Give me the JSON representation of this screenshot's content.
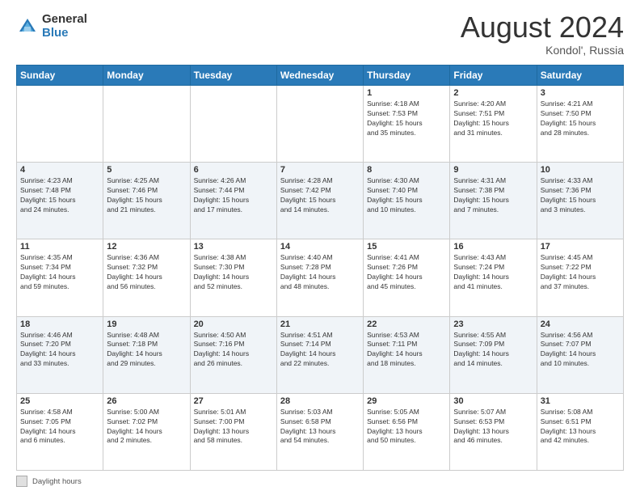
{
  "header": {
    "logo_general": "General",
    "logo_blue": "Blue",
    "month_title": "August 2024",
    "location": "Kondol', Russia"
  },
  "footer": {
    "label": "Daylight hours"
  },
  "days_of_week": [
    "Sunday",
    "Monday",
    "Tuesday",
    "Wednesday",
    "Thursday",
    "Friday",
    "Saturday"
  ],
  "weeks": [
    [
      {
        "num": "",
        "info": ""
      },
      {
        "num": "",
        "info": ""
      },
      {
        "num": "",
        "info": ""
      },
      {
        "num": "",
        "info": ""
      },
      {
        "num": "1",
        "info": "Sunrise: 4:18 AM\nSunset: 7:53 PM\nDaylight: 15 hours\nand 35 minutes."
      },
      {
        "num": "2",
        "info": "Sunrise: 4:20 AM\nSunset: 7:51 PM\nDaylight: 15 hours\nand 31 minutes."
      },
      {
        "num": "3",
        "info": "Sunrise: 4:21 AM\nSunset: 7:50 PM\nDaylight: 15 hours\nand 28 minutes."
      }
    ],
    [
      {
        "num": "4",
        "info": "Sunrise: 4:23 AM\nSunset: 7:48 PM\nDaylight: 15 hours\nand 24 minutes."
      },
      {
        "num": "5",
        "info": "Sunrise: 4:25 AM\nSunset: 7:46 PM\nDaylight: 15 hours\nand 21 minutes."
      },
      {
        "num": "6",
        "info": "Sunrise: 4:26 AM\nSunset: 7:44 PM\nDaylight: 15 hours\nand 17 minutes."
      },
      {
        "num": "7",
        "info": "Sunrise: 4:28 AM\nSunset: 7:42 PM\nDaylight: 15 hours\nand 14 minutes."
      },
      {
        "num": "8",
        "info": "Sunrise: 4:30 AM\nSunset: 7:40 PM\nDaylight: 15 hours\nand 10 minutes."
      },
      {
        "num": "9",
        "info": "Sunrise: 4:31 AM\nSunset: 7:38 PM\nDaylight: 15 hours\nand 7 minutes."
      },
      {
        "num": "10",
        "info": "Sunrise: 4:33 AM\nSunset: 7:36 PM\nDaylight: 15 hours\nand 3 minutes."
      }
    ],
    [
      {
        "num": "11",
        "info": "Sunrise: 4:35 AM\nSunset: 7:34 PM\nDaylight: 14 hours\nand 59 minutes."
      },
      {
        "num": "12",
        "info": "Sunrise: 4:36 AM\nSunset: 7:32 PM\nDaylight: 14 hours\nand 56 minutes."
      },
      {
        "num": "13",
        "info": "Sunrise: 4:38 AM\nSunset: 7:30 PM\nDaylight: 14 hours\nand 52 minutes."
      },
      {
        "num": "14",
        "info": "Sunrise: 4:40 AM\nSunset: 7:28 PM\nDaylight: 14 hours\nand 48 minutes."
      },
      {
        "num": "15",
        "info": "Sunrise: 4:41 AM\nSunset: 7:26 PM\nDaylight: 14 hours\nand 45 minutes."
      },
      {
        "num": "16",
        "info": "Sunrise: 4:43 AM\nSunset: 7:24 PM\nDaylight: 14 hours\nand 41 minutes."
      },
      {
        "num": "17",
        "info": "Sunrise: 4:45 AM\nSunset: 7:22 PM\nDaylight: 14 hours\nand 37 minutes."
      }
    ],
    [
      {
        "num": "18",
        "info": "Sunrise: 4:46 AM\nSunset: 7:20 PM\nDaylight: 14 hours\nand 33 minutes."
      },
      {
        "num": "19",
        "info": "Sunrise: 4:48 AM\nSunset: 7:18 PM\nDaylight: 14 hours\nand 29 minutes."
      },
      {
        "num": "20",
        "info": "Sunrise: 4:50 AM\nSunset: 7:16 PM\nDaylight: 14 hours\nand 26 minutes."
      },
      {
        "num": "21",
        "info": "Sunrise: 4:51 AM\nSunset: 7:14 PM\nDaylight: 14 hours\nand 22 minutes."
      },
      {
        "num": "22",
        "info": "Sunrise: 4:53 AM\nSunset: 7:11 PM\nDaylight: 14 hours\nand 18 minutes."
      },
      {
        "num": "23",
        "info": "Sunrise: 4:55 AM\nSunset: 7:09 PM\nDaylight: 14 hours\nand 14 minutes."
      },
      {
        "num": "24",
        "info": "Sunrise: 4:56 AM\nSunset: 7:07 PM\nDaylight: 14 hours\nand 10 minutes."
      }
    ],
    [
      {
        "num": "25",
        "info": "Sunrise: 4:58 AM\nSunset: 7:05 PM\nDaylight: 14 hours\nand 6 minutes."
      },
      {
        "num": "26",
        "info": "Sunrise: 5:00 AM\nSunset: 7:02 PM\nDaylight: 14 hours\nand 2 minutes."
      },
      {
        "num": "27",
        "info": "Sunrise: 5:01 AM\nSunset: 7:00 PM\nDaylight: 13 hours\nand 58 minutes."
      },
      {
        "num": "28",
        "info": "Sunrise: 5:03 AM\nSunset: 6:58 PM\nDaylight: 13 hours\nand 54 minutes."
      },
      {
        "num": "29",
        "info": "Sunrise: 5:05 AM\nSunset: 6:56 PM\nDaylight: 13 hours\nand 50 minutes."
      },
      {
        "num": "30",
        "info": "Sunrise: 5:07 AM\nSunset: 6:53 PM\nDaylight: 13 hours\nand 46 minutes."
      },
      {
        "num": "31",
        "info": "Sunrise: 5:08 AM\nSunset: 6:51 PM\nDaylight: 13 hours\nand 42 minutes."
      }
    ]
  ]
}
